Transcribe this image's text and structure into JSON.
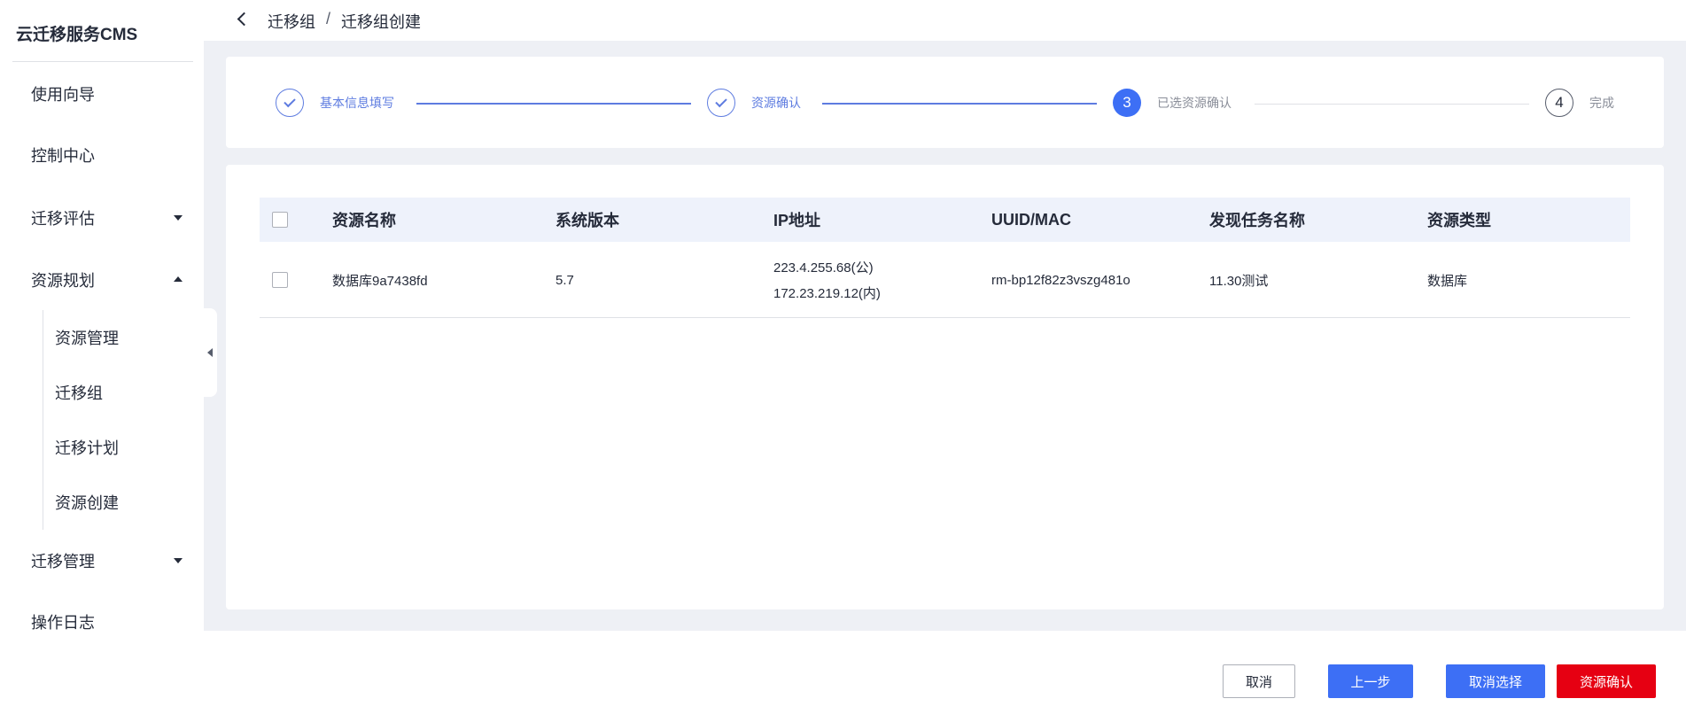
{
  "app": {
    "title": "云迁移服务CMS"
  },
  "sidebar": {
    "items": [
      {
        "label": "使用向导"
      },
      {
        "label": "控制中心"
      },
      {
        "label": "迁移评估"
      },
      {
        "label": "资源规划"
      },
      {
        "label": "迁移管理"
      },
      {
        "label": "操作日志"
      }
    ],
    "sub_items": [
      {
        "label": "资源管理"
      },
      {
        "label": "迁移组"
      },
      {
        "label": "迁移计划"
      },
      {
        "label": "资源创建"
      }
    ]
  },
  "breadcrumb": {
    "parent": "迁移组",
    "separator": "/",
    "current": "迁移组创建"
  },
  "steps": [
    {
      "label": "基本信息填写",
      "state": "done"
    },
    {
      "label": "资源确认",
      "state": "done"
    },
    {
      "label": "已选资源确认",
      "number": "3",
      "state": "active"
    },
    {
      "label": "完成",
      "number": "4",
      "state": "pending"
    }
  ],
  "table": {
    "headers": [
      "资源名称",
      "系统版本",
      "IP地址",
      "UUID/MAC",
      "发现任务名称",
      "资源类型"
    ],
    "rows": [
      {
        "name": "数据库9a7438fd",
        "version": "5.7",
        "ip_public": "223.4.255.68(公)",
        "ip_private": "172.23.219.12(内)",
        "uuid": "rm-bp12f82z3vszg481o",
        "task": "11.30测试",
        "type": "数据库"
      }
    ]
  },
  "footer": {
    "cancel_label": "取消",
    "prev_label": "上一步",
    "deselect_label": "取消选择",
    "confirm_label": "资源确认"
  },
  "colors": {
    "primary": "#3d6ff5",
    "danger": "#e60012",
    "done": "#5e7ce0"
  }
}
